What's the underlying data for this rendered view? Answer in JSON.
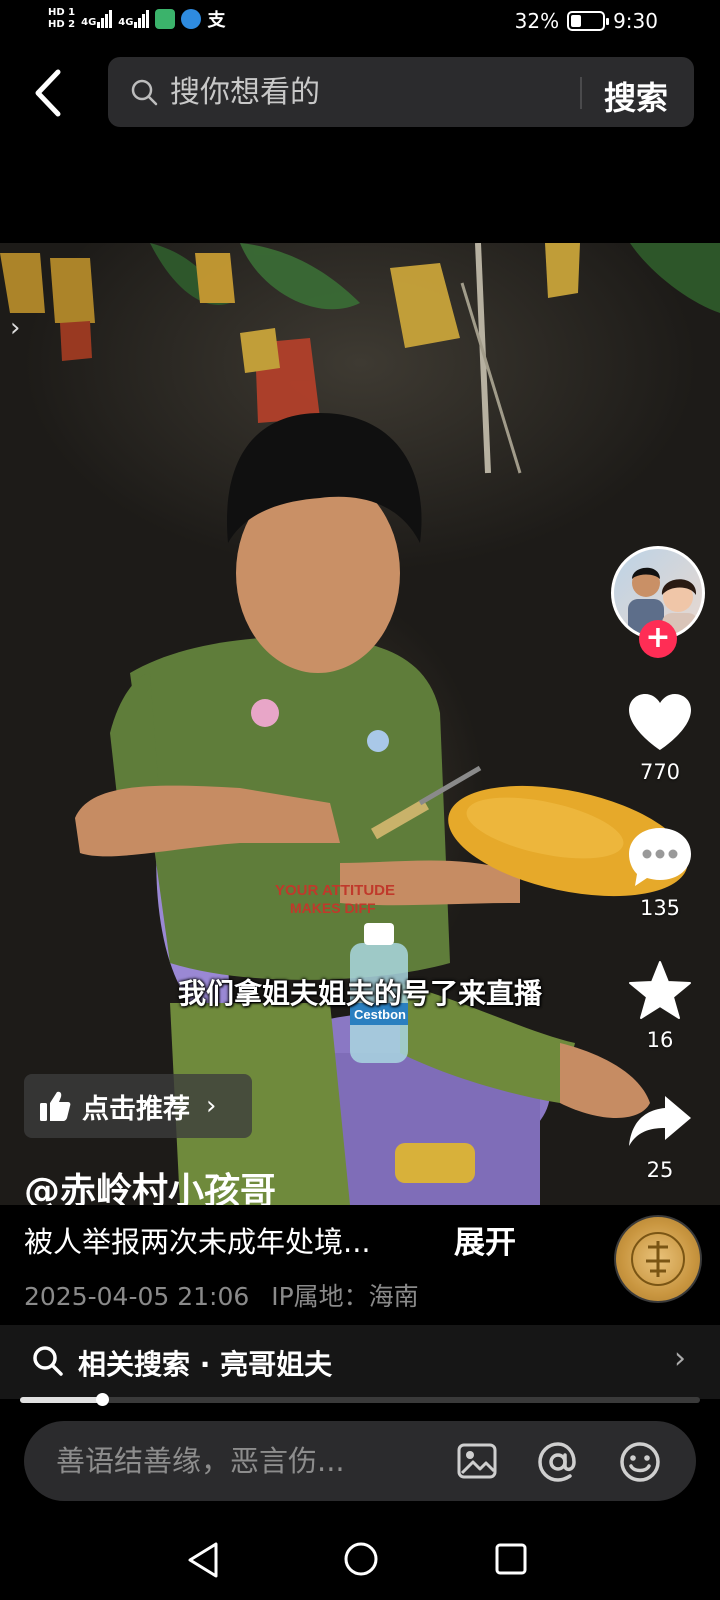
{
  "status_bar": {
    "hd1": "HD 1",
    "hd2": "HD 2",
    "net1": "4G",
    "net2": "4G",
    "battery_text": "32%",
    "battery_level": 0.32,
    "time": "9:30"
  },
  "header": {
    "search_placeholder": "搜你想看的",
    "search_button": "搜索"
  },
  "video": {
    "subtitle": "我们拿姐夫姐夫的号了来直播",
    "bottle_text": "Cestbon",
    "shirt_text_1": "YOUR ATTITUDE",
    "shirt_text_2": "MAKES DIFF"
  },
  "actions": {
    "likes": "770",
    "comments": "135",
    "favorites": "16",
    "shares": "25"
  },
  "recommend": {
    "label": "点击推荐"
  },
  "author": "@赤岭村小孩哥",
  "info": {
    "description": "被人举报两次未成年处境...",
    "expand": "展开",
    "datetime": "2025-04-05 21:06",
    "ip_location": "IP属地：海南"
  },
  "related_search": {
    "label": "相关搜索 · 亮哥姐夫"
  },
  "playback": {
    "progress": 0.12
  },
  "comment": {
    "placeholder": "善语结善缘，恶言伤..."
  },
  "colors": {
    "follow_accent": "#ff2d55",
    "search_bg": "#2b2b2d"
  },
  "icons": [
    "back-arrow-icon",
    "search-icon",
    "heart-icon",
    "comment-icon",
    "star-icon",
    "share-icon",
    "thumbs-up-icon",
    "image-icon",
    "at-icon",
    "emoji-icon",
    "nav-back-icon",
    "nav-home-icon",
    "nav-recents-icon"
  ]
}
